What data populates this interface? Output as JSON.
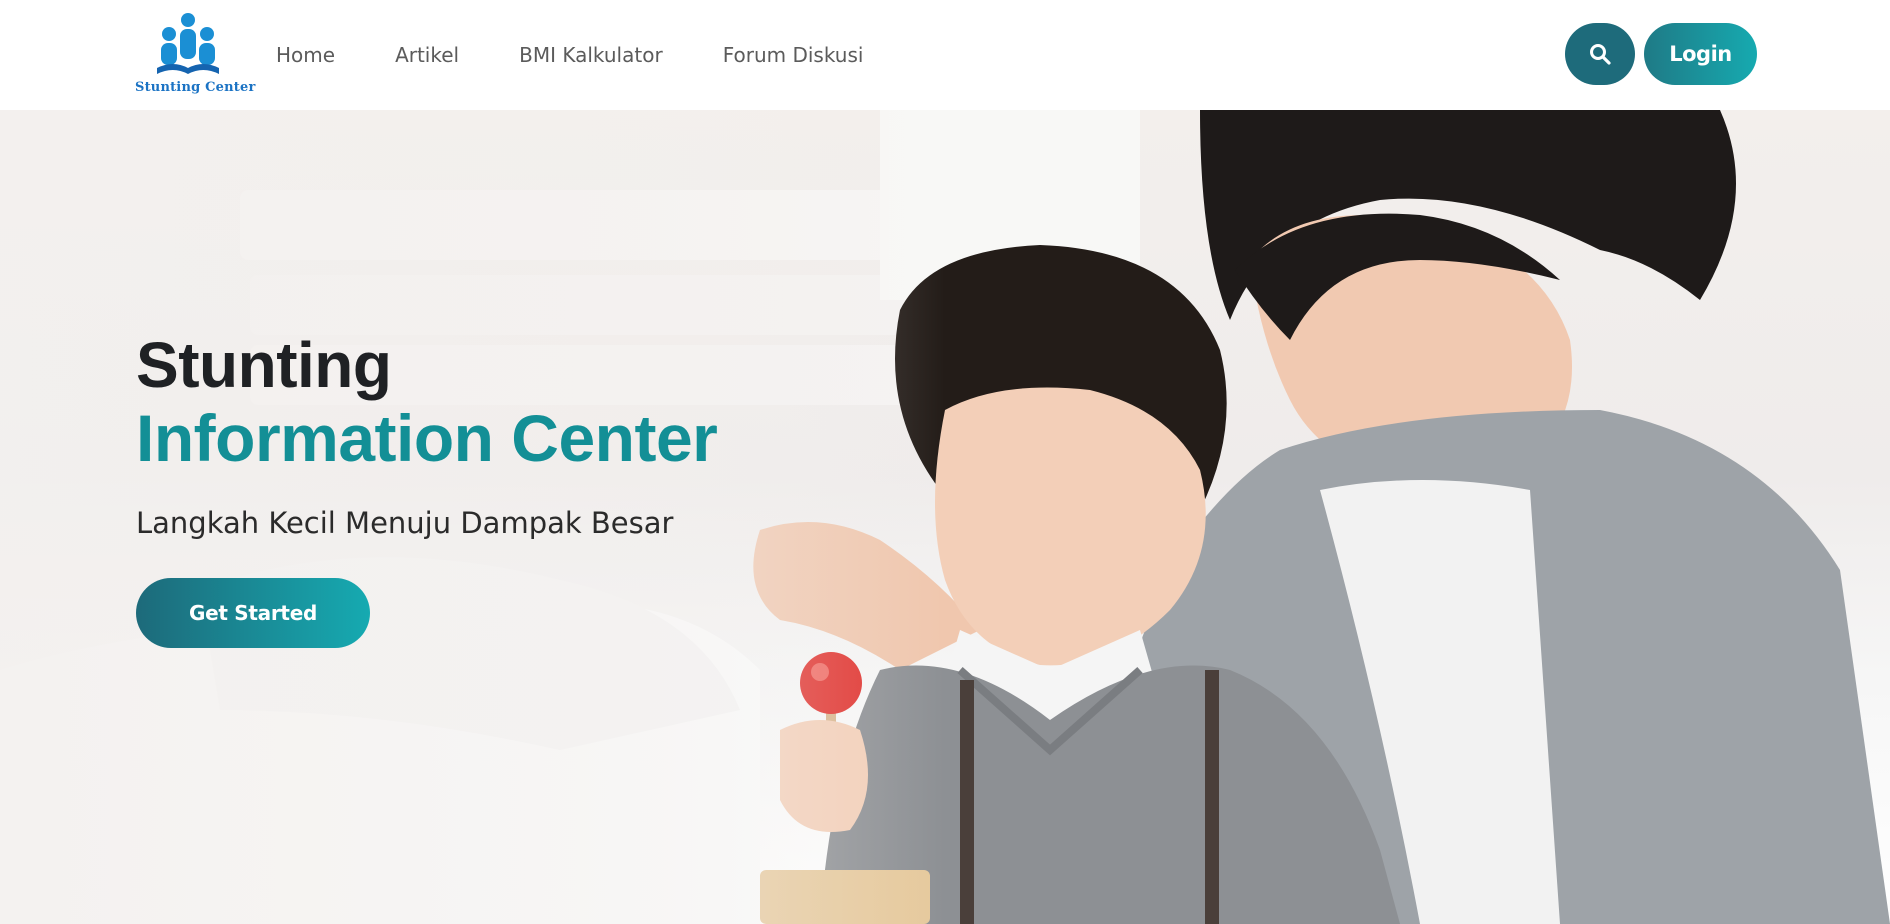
{
  "header": {
    "logo_text": "Stunting Center",
    "nav": [
      {
        "label": "Home"
      },
      {
        "label": "Artikel"
      },
      {
        "label": "BMI Kalkulator"
      },
      {
        "label": "Forum Diskusi"
      }
    ],
    "search_icon": "search-icon",
    "login_label": "Login"
  },
  "hero": {
    "title_line1": "Stunting",
    "title_line2": "Information Center",
    "subtitle": "Langkah Kecil Menuju Dampak Besar",
    "cta_label": "Get Started"
  },
  "colors": {
    "accent": "#138f96",
    "button_dark": "#1e6b7b",
    "button_light": "#16aab0",
    "logo_blue": "#1b73c4"
  }
}
